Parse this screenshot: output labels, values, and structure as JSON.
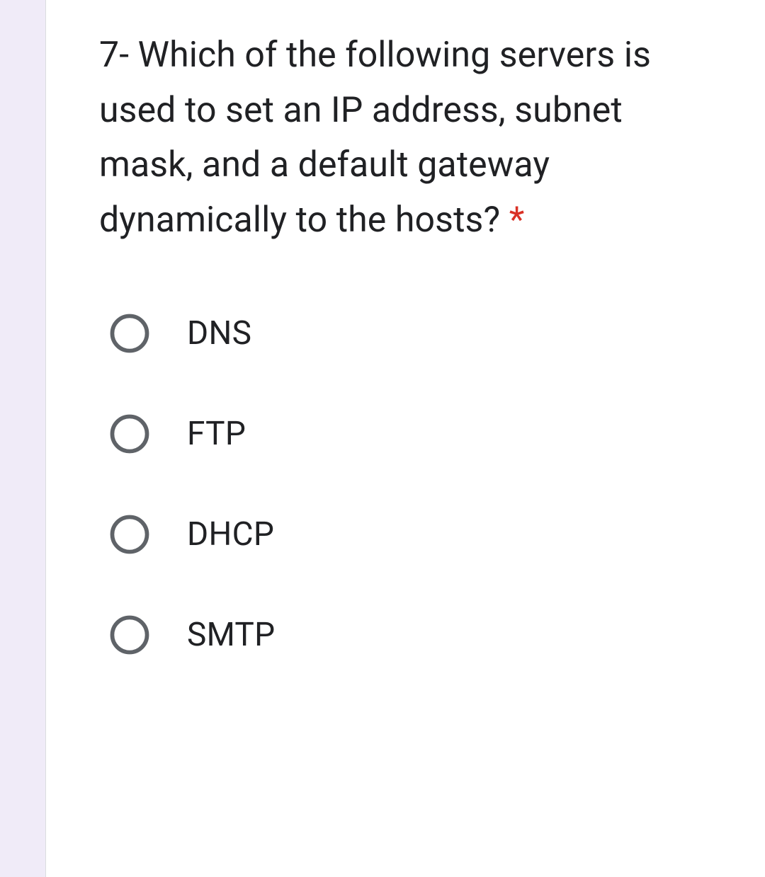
{
  "question": {
    "text": "7- Which of the following servers is used to set an IP address, subnet mask, and a default gateway dynamically to the hosts?",
    "required_marker": "*"
  },
  "options": [
    {
      "label": "DNS"
    },
    {
      "label": "FTP"
    },
    {
      "label": "DHCP"
    },
    {
      "label": "SMTP"
    }
  ],
  "colors": {
    "text": "#202124",
    "required": "#d93025",
    "radio_border": "#5f6368"
  }
}
